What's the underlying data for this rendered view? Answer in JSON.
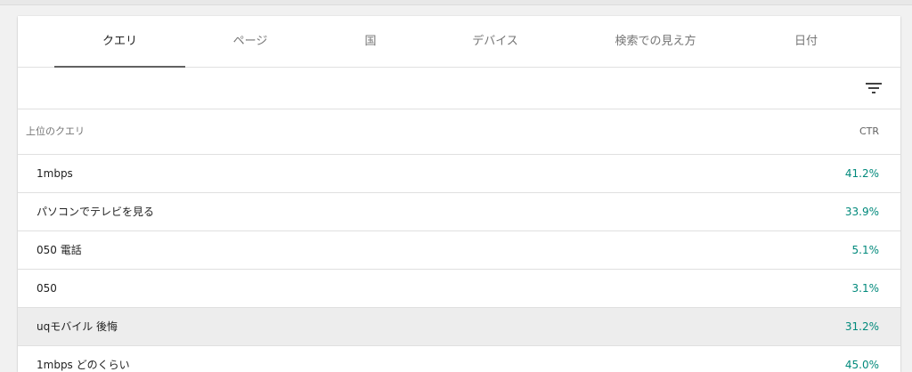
{
  "tabs": [
    {
      "label": "クエリ"
    },
    {
      "label": "ページ"
    },
    {
      "label": "国"
    },
    {
      "label": "デバイス"
    },
    {
      "label": "検索での見え方"
    },
    {
      "label": "日付"
    }
  ],
  "toolbar": {
    "filter_icon": "filter-list-icon"
  },
  "table": {
    "col_query": "上位のクエリ",
    "col_ctr": "CTR",
    "rows": [
      {
        "query": "1mbps",
        "ctr": "41.2%"
      },
      {
        "query": "パソコンでテレビを見る",
        "ctr": "33.9%"
      },
      {
        "query": "050 電話",
        "ctr": "5.1%"
      },
      {
        "query": "050",
        "ctr": "3.1%"
      },
      {
        "query": "uqモバイル 後悔",
        "ctr": "31.2%"
      },
      {
        "query": "1mbps どのくらい",
        "ctr": "45.0%"
      }
    ]
  },
  "colors": {
    "ctr_value": "#00897b",
    "active_tab_indicator": "#616161",
    "hover_row": "#ededed"
  }
}
